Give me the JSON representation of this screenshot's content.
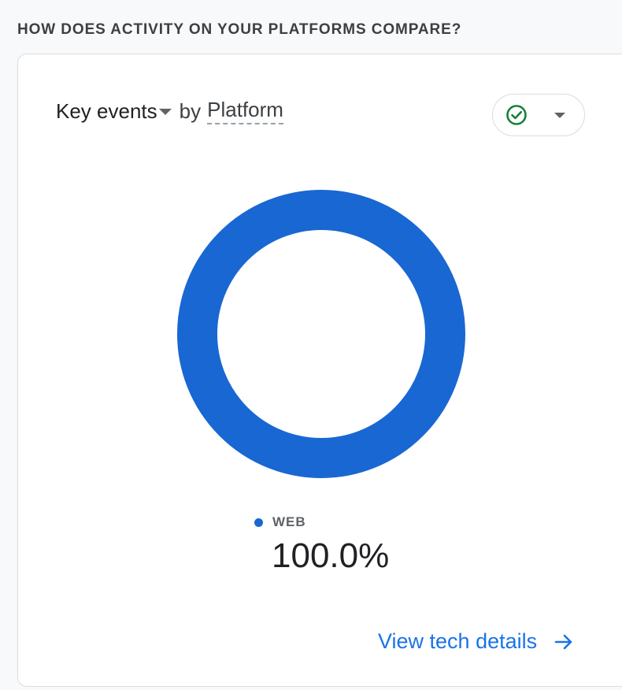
{
  "section_title": "HOW DOES ACTIVITY ON YOUR PLATFORMS COMPARE?",
  "card": {
    "metric_label": "Key events",
    "by_label": "by",
    "dimension_label": "Platform",
    "status_icon": "check-circle-icon",
    "link_label": "View tech details"
  },
  "colors": {
    "accent": "#1a73e8",
    "donut_blue": "#1967d2",
    "status_green": "#188038"
  },
  "chart_data": {
    "type": "pie",
    "categories": [
      "WEB"
    ],
    "values": [
      100.0
    ],
    "value_labels": [
      "100.0%"
    ]
  }
}
